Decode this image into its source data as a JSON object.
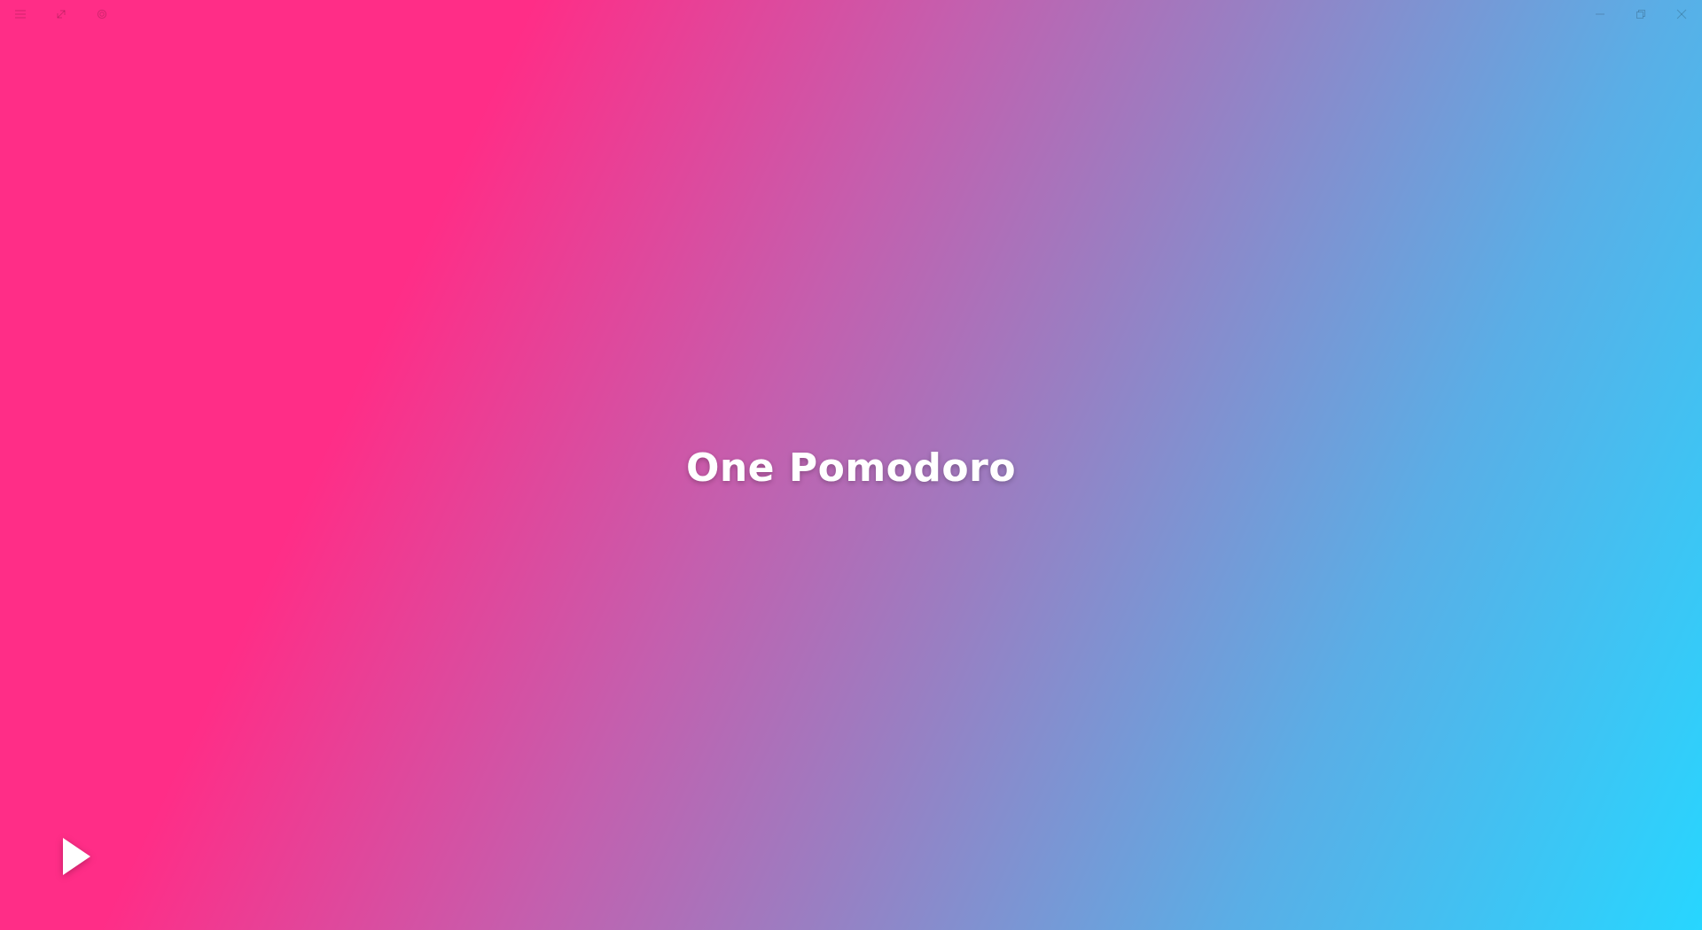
{
  "app": {
    "title": "One Pomodoro",
    "gradient_colors": [
      "#ff2d87",
      "#c45fae",
      "#9a7ec2",
      "#5aaee6",
      "#27d6ff"
    ]
  },
  "titlebar": {
    "left_icons": [
      "menu-icon",
      "compact-overlay-icon",
      "settings-icon"
    ],
    "right_icons": [
      "minimize-icon",
      "restore-icon",
      "close-icon"
    ]
  },
  "controls": {
    "play_icon": "play-icon",
    "play_color": "#ffffff"
  }
}
